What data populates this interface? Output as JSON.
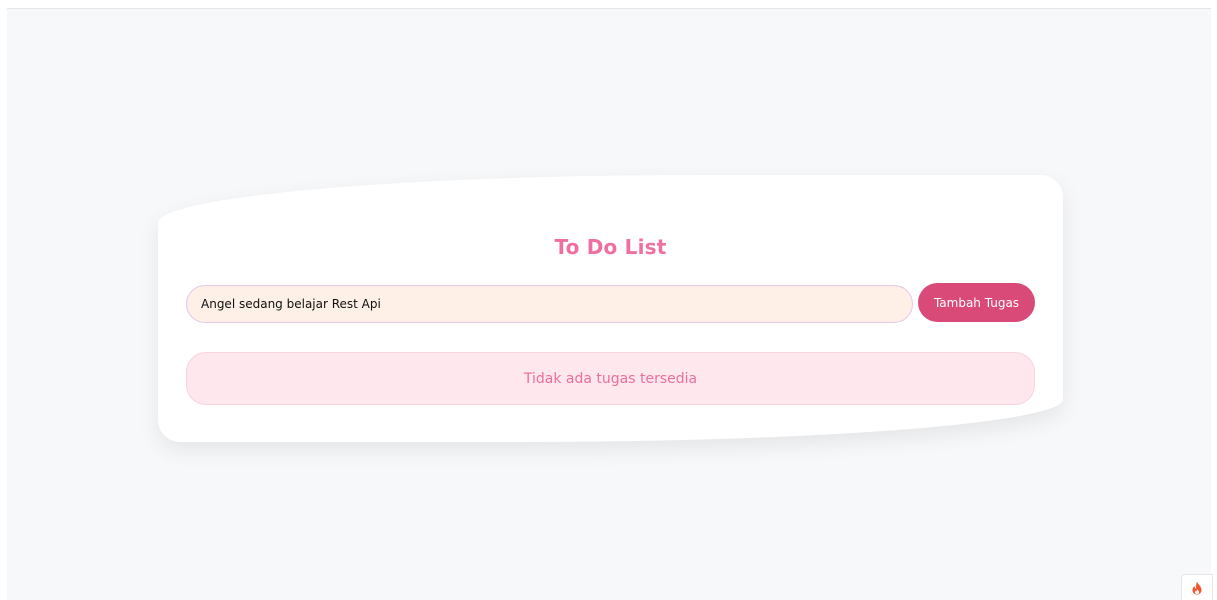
{
  "card": {
    "title": "To Do List",
    "input": {
      "value": "Angel sedang belajar Rest Api",
      "placeholder": ""
    },
    "add_button_label": "Tambah Tugas",
    "empty_message": "Tidak ada tugas tersedia"
  },
  "corner_widget": {
    "icon": "flame-icon"
  },
  "colors": {
    "accent_pink": "#f06fa0",
    "button": "#d94a78",
    "input_bg": "#fef0e6",
    "empty_bg": "#ffe7ee",
    "page_bg": "#f7f8fa",
    "flame": "#f0562c"
  }
}
